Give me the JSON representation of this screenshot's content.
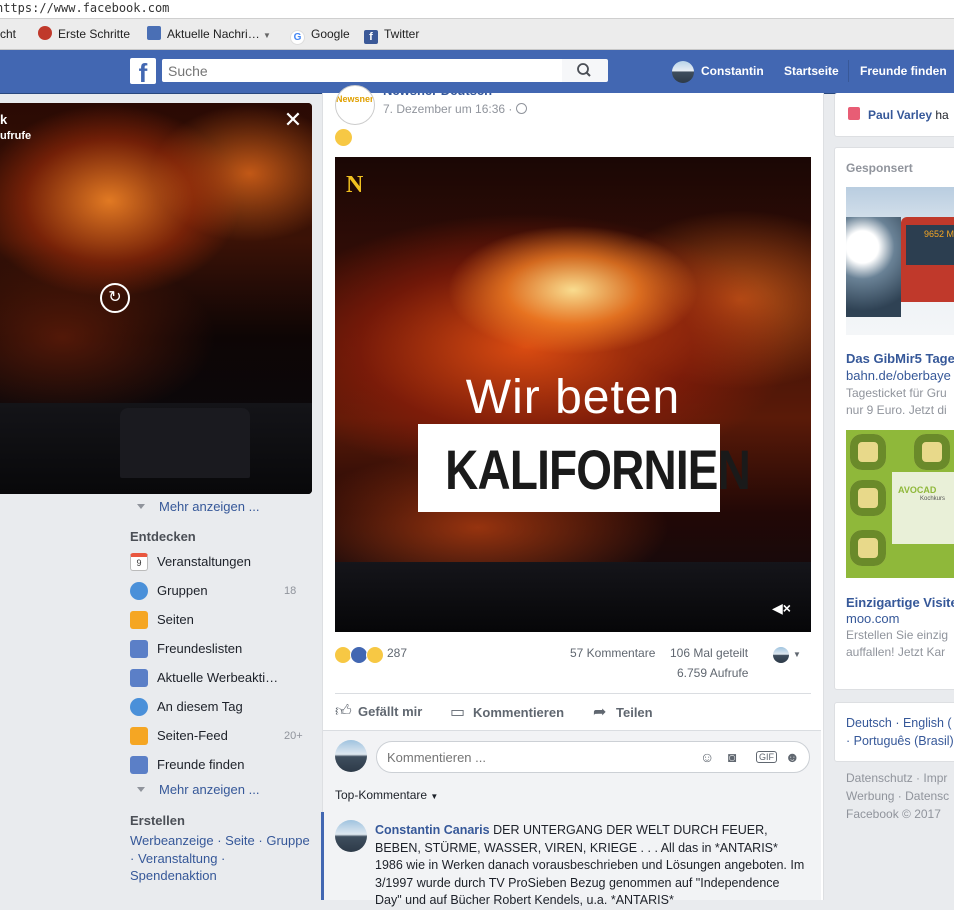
{
  "browser": {
    "url": "https://www.facebook.com",
    "bookmarks": [
      {
        "label": "cht",
        "icon": "none"
      },
      {
        "label": "Erste Schritte",
        "icon": "firefox-icon"
      },
      {
        "label": "Aktuelle Nachri…",
        "icon": "rss-icon"
      },
      {
        "label": "Google",
        "icon": "google-icon"
      },
      {
        "label": "Twitter",
        "icon": "facebook-icon"
      }
    ]
  },
  "header": {
    "logo": "f",
    "search_placeholder": "Suche",
    "user_name": "Constantin",
    "nav": [
      "Startseite",
      "Freunde finden"
    ]
  },
  "video_popup": {
    "title": "k",
    "subtitle": "ufrufe"
  },
  "left_nav": {
    "more_label": "Mehr anzeigen ...",
    "discover_heading": "Entdecken",
    "calendar_day": "9",
    "items": [
      {
        "label": "Veranstaltungen",
        "count": "",
        "color": "#e9573f"
      },
      {
        "label": "Gruppen",
        "count": "18",
        "color": "#4a90d9"
      },
      {
        "label": "Seiten",
        "count": "",
        "color": "#f5a623"
      },
      {
        "label": "Freundeslisten",
        "count": "",
        "color": "#5b7fc7"
      },
      {
        "label": "Aktuelle Werbeakti…",
        "count": "",
        "color": "#5b7fc7"
      },
      {
        "label": "An diesem Tag",
        "count": "",
        "color": "#4a90d9"
      },
      {
        "label": "Seiten-Feed",
        "count": "20+",
        "color": "#f5a623"
      },
      {
        "label": "Freunde finden",
        "count": "",
        "color": "#5b7fc7"
      }
    ],
    "more_label_2": "Mehr anzeigen ...",
    "create_heading": "Erstellen",
    "create_links_line1": "Werbeanzeige · Seite · Gruppe",
    "create_links_line2": "· Veranstaltung ·",
    "create_links_line3": "Spendenaktion"
  },
  "post": {
    "page_name": "Newsner Deutsch",
    "page_logo_text": "Newsner",
    "date": "7. Dezember um 16:36 · ",
    "video_logo": "N",
    "video_line1": "Wir beten",
    "video_line2": "KALIFORNIEN",
    "mute_icon": "◀×",
    "reaction_count": "287",
    "comments": "57 Kommentare",
    "shares": "106 Mal geteilt",
    "views": "6.759 Aufrufe",
    "actions": [
      "Gefällt mir",
      "Kommentieren",
      "Teilen"
    ],
    "comment_placeholder": "Kommentieren ...",
    "comment_icons": [
      "☺",
      "◙",
      "GIF",
      "☻"
    ],
    "top_comments": "Top-Kommentare",
    "comment": {
      "author": "Constantin Canaris",
      "text": " DER UNTERGANG DER WELT DURCH FEUER, BEBEN, STÜRME, WASSER, VIREN, KRIEGE . . . All das in *ANTARIS* 1986 wie in Werken danach vorausbeschrieben und Lösungen angeboten. Im 3/1997 wurde durch TV ProSieben Bezug genommen auf \"Independence Day\" und auf Bücher Robert Kendels, u.a. *ANTARIS*"
    }
  },
  "right": {
    "friend_name": "Paul Varley",
    "friend_suffix": " ha",
    "sponsored": "Gesponsert",
    "ad1": {
      "title": "Das GibMir5 Tage",
      "domain": "bahn.de/oberbaye",
      "text1": "Tagesticket für Gru",
      "text2": "nur 9 Euro. Jetzt di",
      "bus_sign": "9652 Mü"
    },
    "ad2": {
      "title": "Einzigartige Visite",
      "domain": "moo.com",
      "text1": "Erstellen Sie einzig",
      "text2": "auffallen! Jetzt Kar",
      "card_text": "AVOCAD",
      "card_sub": "Kochkurs"
    },
    "languages_line1": "Deutsch · English (",
    "languages_line2": "· Português (Brasil)",
    "footer_line1": "Datenschutz · Impr",
    "footer_line2": "Werbung · Datensc",
    "footer_line3": "Facebook © 2017"
  }
}
